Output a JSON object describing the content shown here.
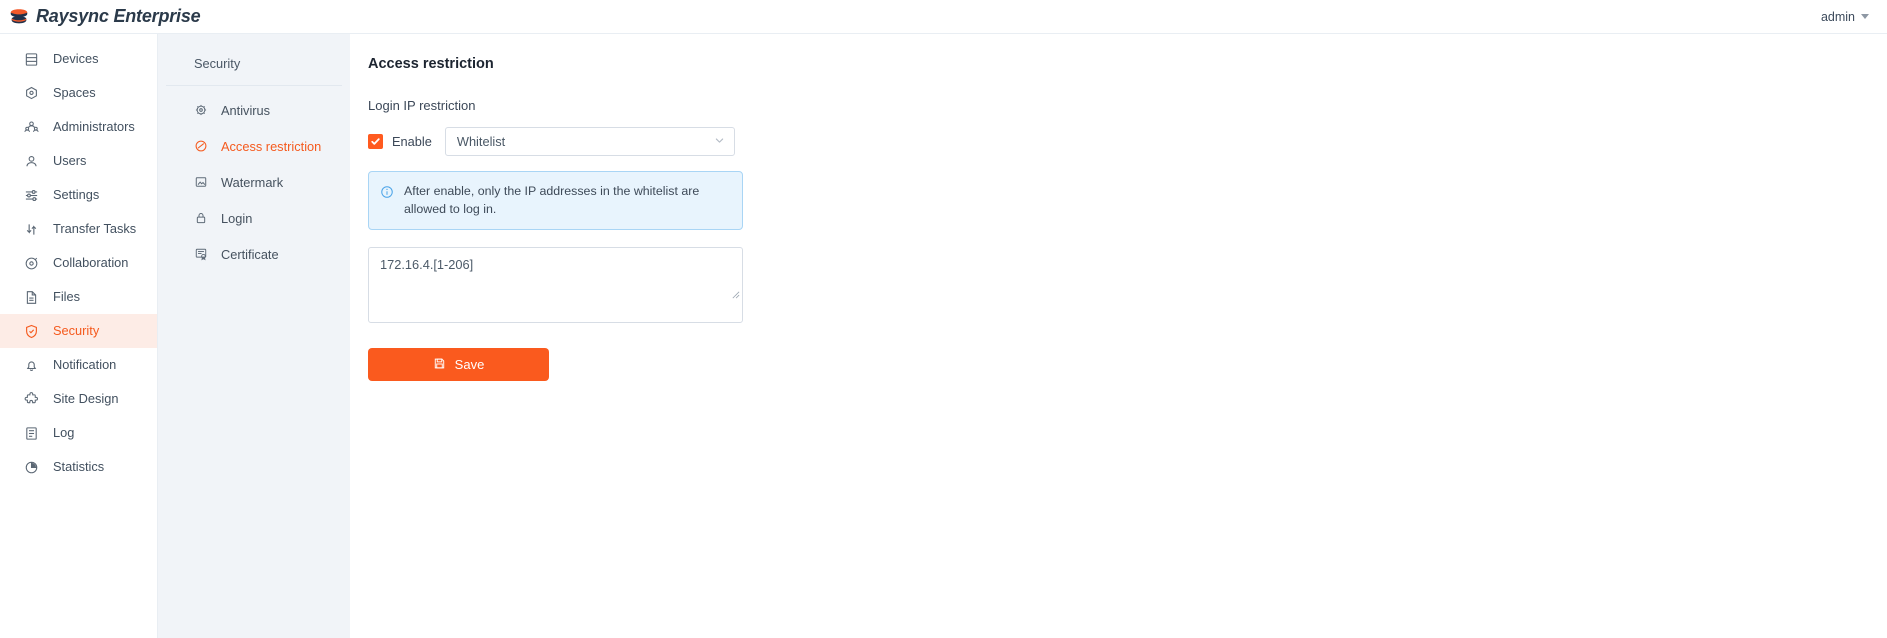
{
  "topbar": {
    "brand_name": "Raysync Enterprise",
    "logo_icon": "raysync-layers-logo",
    "user_label": "admin",
    "user_caret_icon": "chevron-down-icon"
  },
  "sidebar": {
    "items": [
      {
        "label": "Devices",
        "icon": "server-icon",
        "active": false
      },
      {
        "label": "Spaces",
        "icon": "hexagon-home-icon",
        "active": false
      },
      {
        "label": "Administrators",
        "icon": "users-group-icon",
        "active": false
      },
      {
        "label": "Users",
        "icon": "user-icon",
        "active": false
      },
      {
        "label": "Settings",
        "icon": "sliders-icon",
        "active": false
      },
      {
        "label": "Transfer Tasks",
        "icon": "transfer-icon",
        "active": false
      },
      {
        "label": "Collaboration",
        "icon": "orbit-icon",
        "active": false
      },
      {
        "label": "Files",
        "icon": "file-icon",
        "active": false
      },
      {
        "label": "Security",
        "icon": "shield-check-icon",
        "active": true
      },
      {
        "label": "Notification",
        "icon": "bell-icon",
        "active": false
      },
      {
        "label": "Site Design",
        "icon": "puzzle-icon",
        "active": false
      },
      {
        "label": "Log",
        "icon": "log-book-icon",
        "active": false
      },
      {
        "label": "Statistics",
        "icon": "pie-chart-icon",
        "active": false
      }
    ]
  },
  "subnav": {
    "title": "Security",
    "items": [
      {
        "label": "Antivirus",
        "icon": "virus-shield-icon",
        "active": false
      },
      {
        "label": "Access restriction",
        "icon": "access-block-icon",
        "active": true
      },
      {
        "label": "Watermark",
        "icon": "watermark-image-icon",
        "active": false
      },
      {
        "label": "Login",
        "icon": "lock-icon",
        "active": false
      },
      {
        "label": "Certificate",
        "icon": "certificate-icon",
        "active": false
      }
    ]
  },
  "main": {
    "page_title": "Access restriction",
    "section_label": "Login IP restriction",
    "enable": {
      "checkbox_icon": "check-icon",
      "checked": true,
      "label": "Enable"
    },
    "mode_select": {
      "value": "Whitelist",
      "chevron_icon": "chevron-down-icon",
      "options": [
        "Whitelist"
      ]
    },
    "alert": {
      "icon": "info-circle-icon",
      "text": "After enable, only the IP addresses in the whitelist are allowed to log in."
    },
    "ip_textarea": {
      "value": "172.16.4.[1-206]",
      "placeholder": "",
      "resize_handle_icon": "resize-grip-icon"
    },
    "save_button": {
      "label": "Save",
      "icon": "save-disk-icon"
    }
  },
  "colors": {
    "accent": "#fa5a1e",
    "accent_soft_bg": "#fdece6",
    "text": "#3c4858",
    "panel_bg": "#f1f4f8",
    "info_bg": "#e8f4fd",
    "info_border": "#a9d5f5"
  }
}
